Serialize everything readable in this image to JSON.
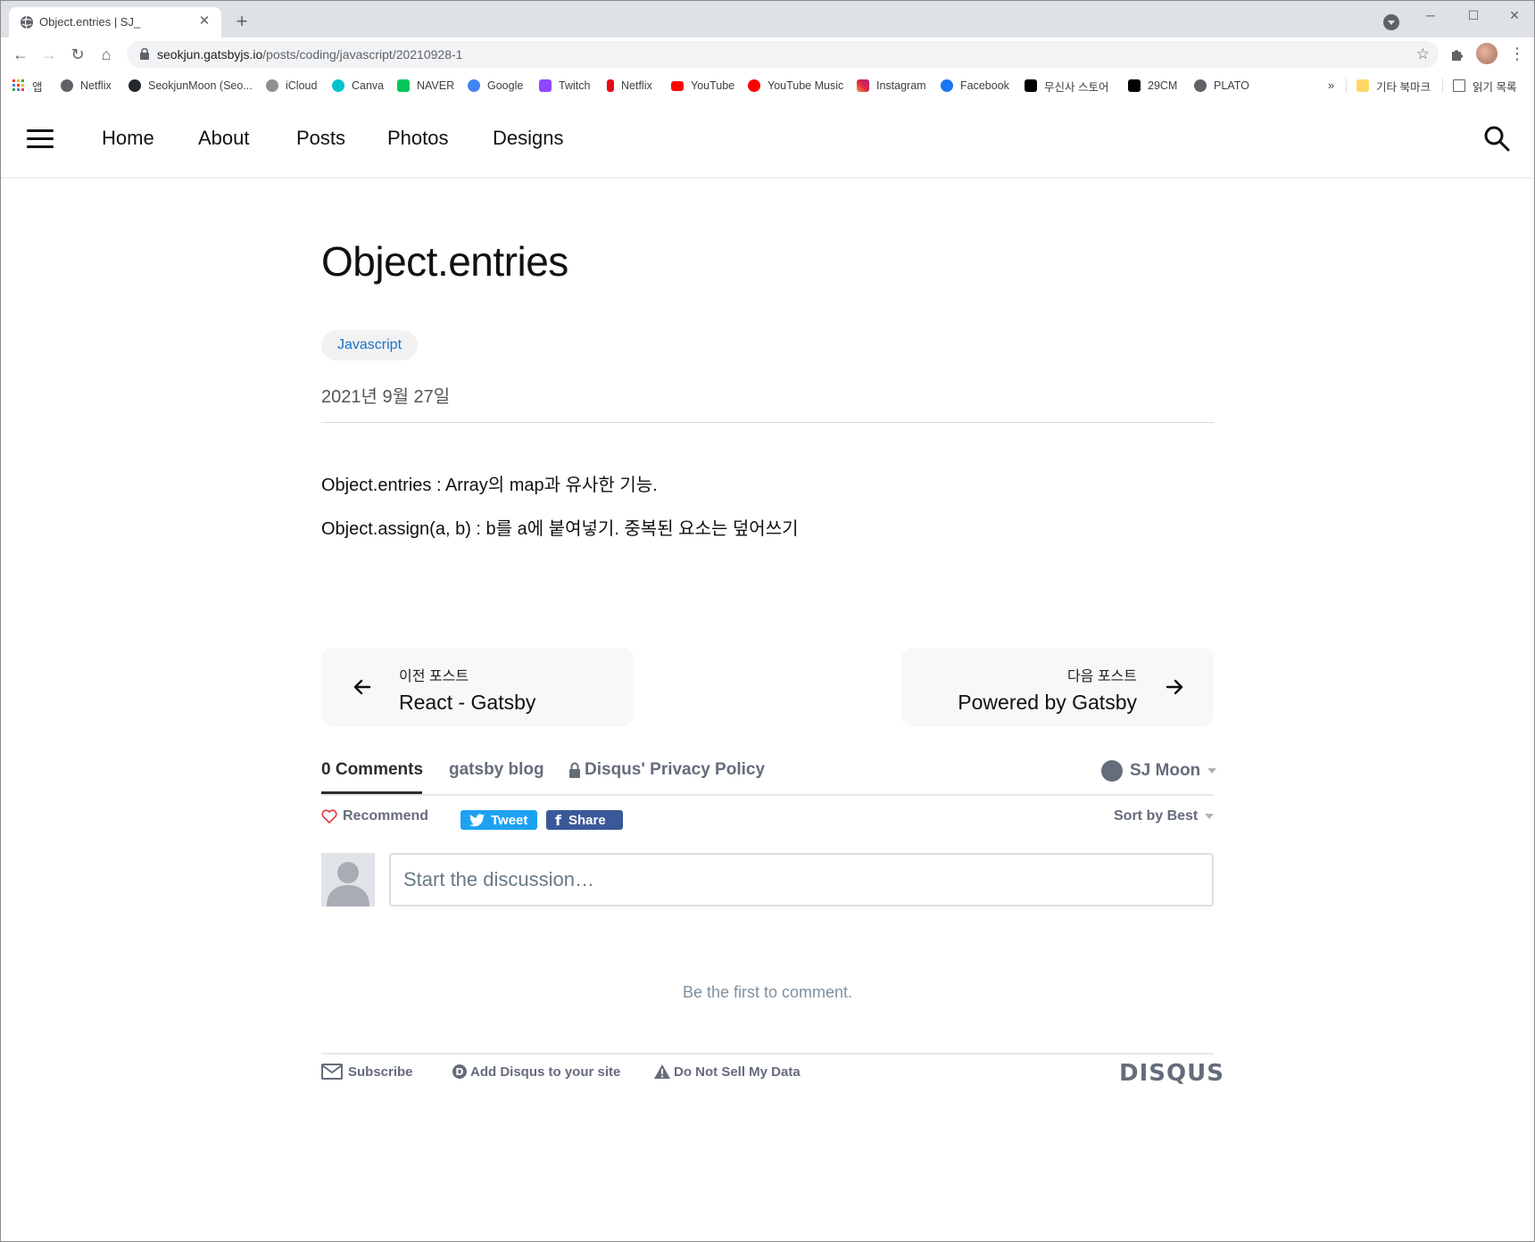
{
  "browser": {
    "tab_title": "Object.entries | SJ_",
    "url_host": "seokjun.gatsbyjs.io",
    "url_path": "/posts/coding/javascript/20210928-1",
    "bookmarks": [
      {
        "label": "앱",
        "color": "#ea4335"
      },
      {
        "label": "Netflix",
        "color": "#5f6368"
      },
      {
        "label": "SeokjunMoon (Seo...",
        "color": "#24292e"
      },
      {
        "label": "iCloud",
        "color": "#8e8e93"
      },
      {
        "label": "Canva",
        "color": "#00c4cc"
      },
      {
        "label": "NAVER",
        "color": "#03c75a"
      },
      {
        "label": "Google",
        "color": "#4285f4"
      },
      {
        "label": "Twitch",
        "color": "#9146ff"
      },
      {
        "label": "Netflix",
        "color": "#e50914"
      },
      {
        "label": "YouTube",
        "color": "#ff0000"
      },
      {
        "label": "YouTube Music",
        "color": "#ff0000"
      },
      {
        "label": "Instagram",
        "color": "#c13584"
      },
      {
        "label": "Facebook",
        "color": "#1877f2"
      },
      {
        "label": "무신사 스토어",
        "color": "#000000"
      },
      {
        "label": "29CM",
        "color": "#000000"
      },
      {
        "label": "PLATO",
        "color": "#5f6368"
      }
    ],
    "overflow_label": "»",
    "other_bookmarks": "기타 북마크",
    "reading_list": "읽기 목록"
  },
  "site": {
    "nav": [
      "Home",
      "About",
      "Posts",
      "Photos",
      "Designs"
    ]
  },
  "post": {
    "title": "Object.entries",
    "tag": "Javascript",
    "date": "2021년 9월 27일",
    "paragraphs": [
      "Object.entries : Array의 map과 유사한 기능.",
      "Object.assign(a, b) : b를 a에 붙여넣기. 중복된 요소는 덮어쓰기"
    ],
    "prev": {
      "label": "이전 포스트",
      "title": "React - Gatsby"
    },
    "next": {
      "label": "다음 포스트",
      "title": "Powered by Gatsby"
    }
  },
  "disqus": {
    "comments_tab": "0 Comments",
    "community": "gatsby blog",
    "privacy": "Disqus' Privacy Policy",
    "user": "SJ Moon",
    "recommend": "Recommend",
    "tweet": "Tweet",
    "share": "Share",
    "sort": "Sort by Best",
    "input_placeholder": "Start the discussion…",
    "empty": "Be the first to comment.",
    "subscribe": "Subscribe",
    "add_disqus": "Add Disqus to your site",
    "do_not_sell": "Do Not Sell My Data",
    "logo": "DISQUS"
  },
  "colors": {
    "tag_text": "#1a73c8",
    "tweet": "#1da1f2",
    "facebook": "#3b5998",
    "disqus_gray": "#656c7a"
  }
}
